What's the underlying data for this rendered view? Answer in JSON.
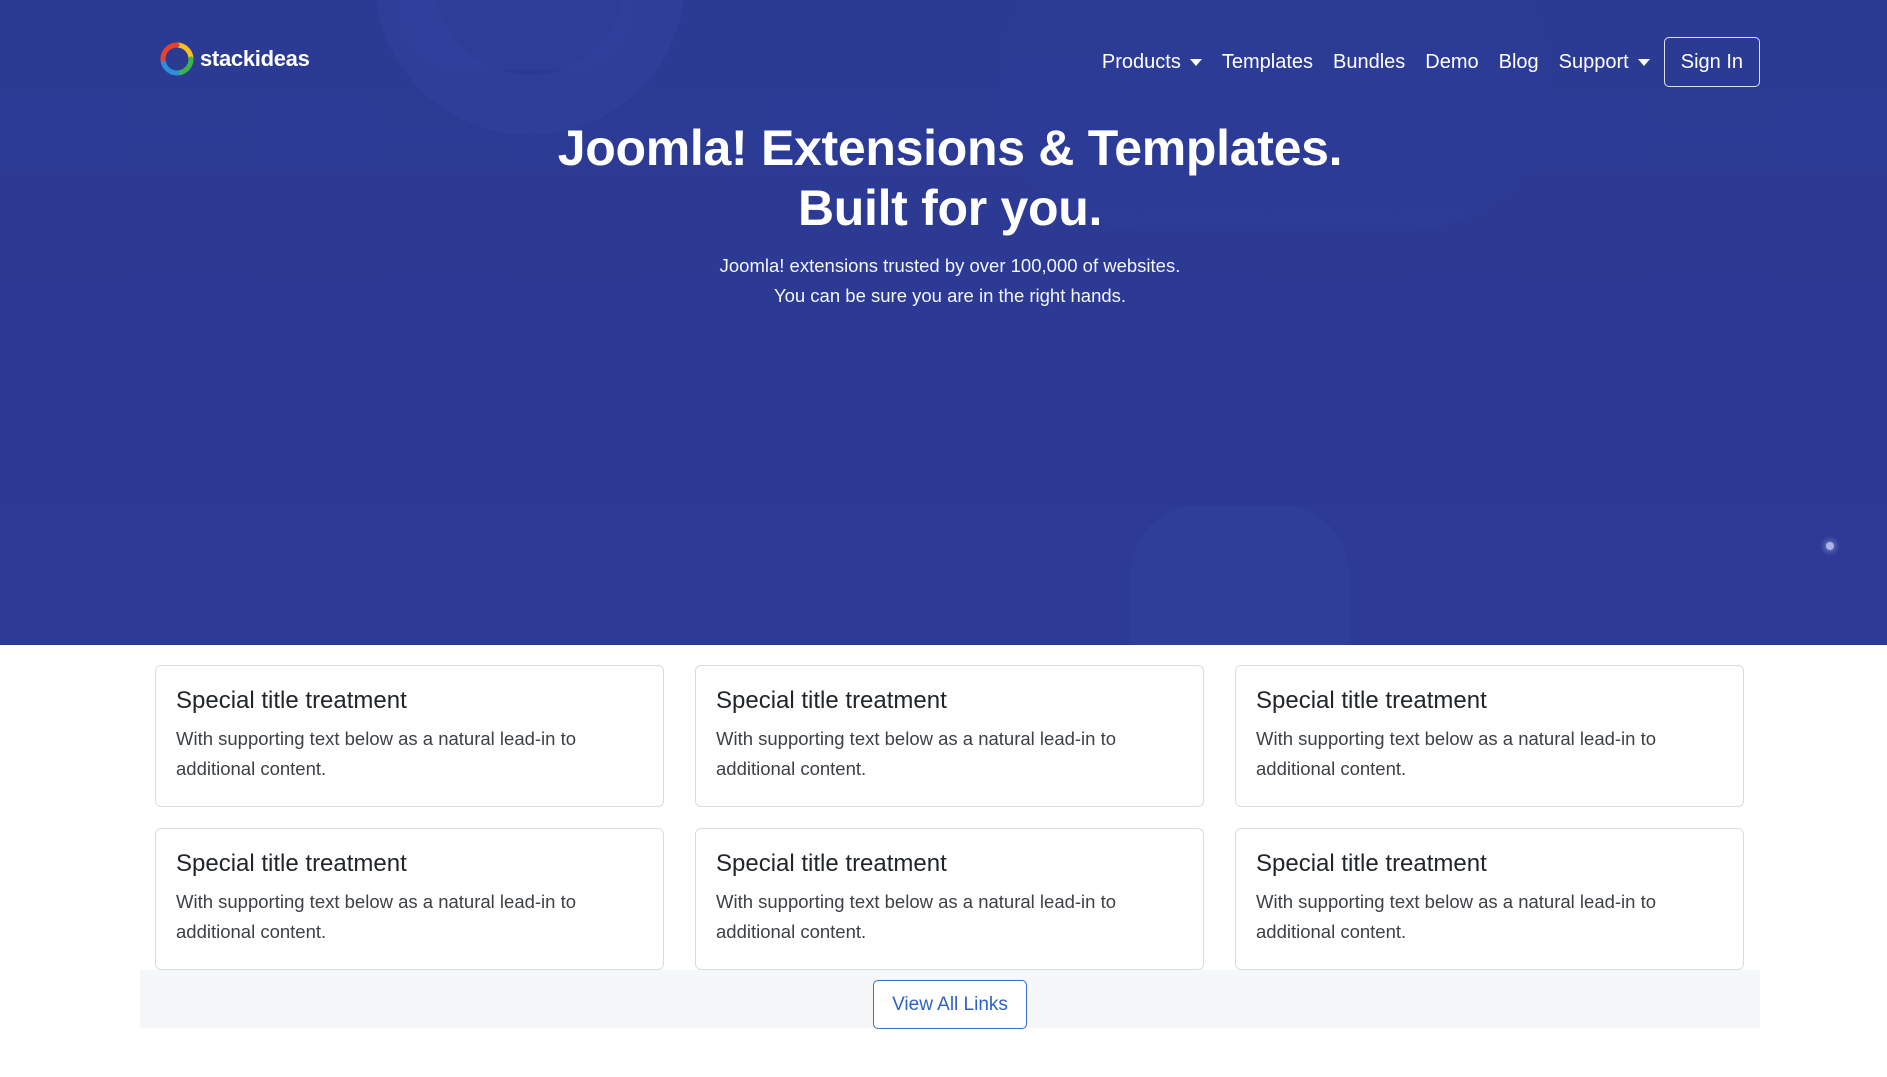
{
  "brand": {
    "name": "stackideas",
    "logo_icon": "stackideas-logo-icon"
  },
  "nav": {
    "items": [
      {
        "label": "Products",
        "dropdown": true
      },
      {
        "label": "Templates",
        "dropdown": false
      },
      {
        "label": "Bundles",
        "dropdown": false
      },
      {
        "label": "Demo",
        "dropdown": false
      },
      {
        "label": "Blog",
        "dropdown": false
      },
      {
        "label": "Support",
        "dropdown": true
      }
    ],
    "signin_label": "Sign In"
  },
  "hero": {
    "title_line1": "Joomla! Extensions & Templates.",
    "title_line2": "Built for you.",
    "subtitle_line1": "Joomla! extensions trusted by over 100,000 of websites.",
    "subtitle_line2": "You can be sure you are in the right hands."
  },
  "cards": [
    {
      "title": "Special title treatment",
      "text": "With supporting text below as a natural lead-in to additional content."
    },
    {
      "title": "Special title treatment",
      "text": "With supporting text below as a natural lead-in to additional content."
    },
    {
      "title": "Special title treatment",
      "text": "With supporting text below as a natural lead-in to additional content."
    },
    {
      "title": "Special title treatment",
      "text": "With supporting text below as a natural lead-in to additional content."
    },
    {
      "title": "Special title treatment",
      "text": "With supporting text below as a natural lead-in to additional content."
    },
    {
      "title": "Special title treatment",
      "text": "With supporting text below as a natural lead-in to additional content."
    }
  ],
  "view_all_label": "View All Links",
  "colors": {
    "hero_bg": "#2c3a95",
    "card_border": "#d9dce0",
    "link_blue": "#2d62c6",
    "strip_bg": "#f6f7f9"
  }
}
